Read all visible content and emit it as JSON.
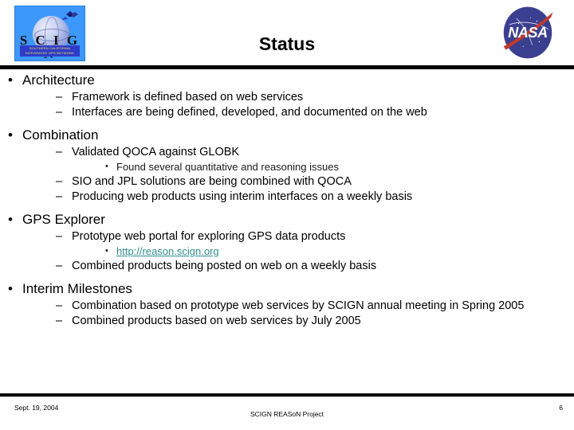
{
  "header": {
    "title": "Status",
    "left_logo": {
      "name": "SCIGN",
      "wordmark": "S C I G N",
      "tagline": "SOUTHERN CALIFORNIA INTEGRATED GPS NETWORK"
    },
    "right_logo": {
      "name": "NASA",
      "wordmark": "NASA"
    }
  },
  "content": {
    "sections": [
      {
        "heading": "Architecture",
        "items": [
          {
            "text": "Framework is defined based on web services",
            "subitems": []
          },
          {
            "text": "Interfaces are being defined, developed, and documented on the web",
            "subitems": []
          }
        ]
      },
      {
        "heading": "Combination",
        "items": [
          {
            "text": "Validated QOCA against GLOBK",
            "subitems": [
              {
                "text": "Found several quantitative and reasoning issues"
              }
            ]
          },
          {
            "text": "SIO and JPL solutions are being combined with QOCA",
            "subitems": []
          },
          {
            "text": "Producing web products using interim interfaces on a weekly basis",
            "subitems": []
          }
        ]
      },
      {
        "heading": "GPS Explorer",
        "items": [
          {
            "text": "Prototype web portal for exploring GPS data products",
            "subitems": [
              {
                "text": "http://reason.scign.org",
                "link": true
              }
            ]
          },
          {
            "text": "Combined products being posted on web on a weekly basis",
            "subitems": []
          }
        ]
      },
      {
        "heading": "Interim Milestones",
        "items": [
          {
            "text": "Combination based on prototype web services by SCIGN annual meeting in Spring 2005",
            "subitems": []
          },
          {
            "text": "Combined products based on web services by July 2005",
            "subitems": []
          }
        ]
      }
    ]
  },
  "footer": {
    "date": "Sept. 19, 2004",
    "center": "SCIGN REASoN Project",
    "page": "6"
  },
  "colors": {
    "link": "#2e8f8f",
    "logo_blue": "#3d98fb",
    "nasa_blue": "#3b3f8f",
    "nasa_red": "#c0392b",
    "rule": "#000000"
  },
  "bullets": {
    "level1": "•",
    "level2": "–",
    "level3": "•"
  }
}
